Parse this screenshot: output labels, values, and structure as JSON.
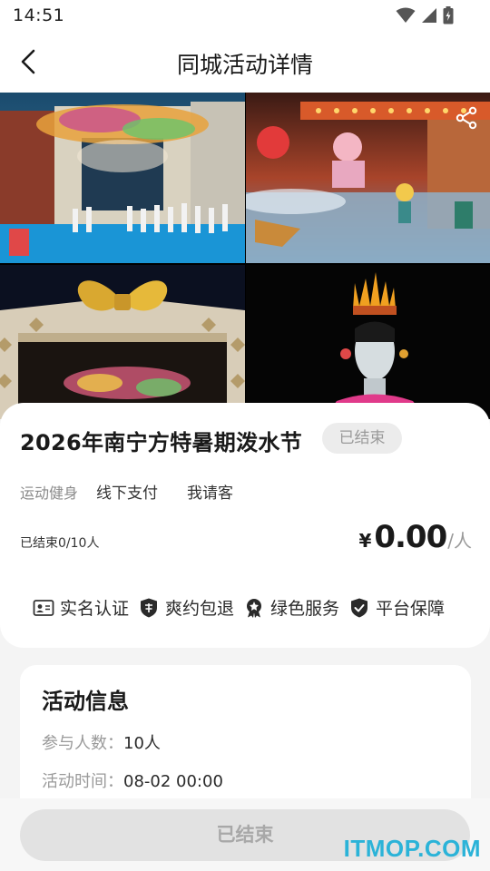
{
  "status_bar": {
    "time": "14:51",
    "icons": [
      "wifi-icon",
      "cell-signal-icon",
      "battery-icon"
    ]
  },
  "header": {
    "title": "同城活动详情",
    "back_icon": "chevron-left-icon",
    "share_icon": "share-icon"
  },
  "gallery": {
    "photos": [
      "photo-garden-stage",
      "photo-cartoon-village",
      "photo-gift-arch",
      "photo-dancer-statue"
    ]
  },
  "event": {
    "title": "2026年南宁方特暑期泼水节",
    "status_badge": "已结束",
    "category": "运动健身",
    "tags": [
      "线下支付",
      "我请客"
    ],
    "participants": "已结束0/10人",
    "currency": "¥",
    "price": "0.00",
    "per_unit": "/人"
  },
  "guarantees": [
    {
      "icon": "id-card-icon",
      "label": "实名认证"
    },
    {
      "icon": "refund-shield-icon",
      "label": "爽约包退"
    },
    {
      "icon": "green-badge-icon",
      "label": "绿色服务"
    },
    {
      "icon": "shield-check-icon",
      "label": "平台保障"
    }
  ],
  "activity_info": {
    "title": "活动信息",
    "rows": [
      {
        "key": "参与人数：",
        "value": "10人"
      },
      {
        "key": "活动时间：",
        "value": "08-02 00:00"
      }
    ]
  },
  "bottom": {
    "button_label": "已结束",
    "watermark": "ITMOP.COM"
  },
  "colors": {
    "badge_bg": "#ececec",
    "button_bg": "#e2e2e2",
    "watermark": "#2bb3d8"
  }
}
